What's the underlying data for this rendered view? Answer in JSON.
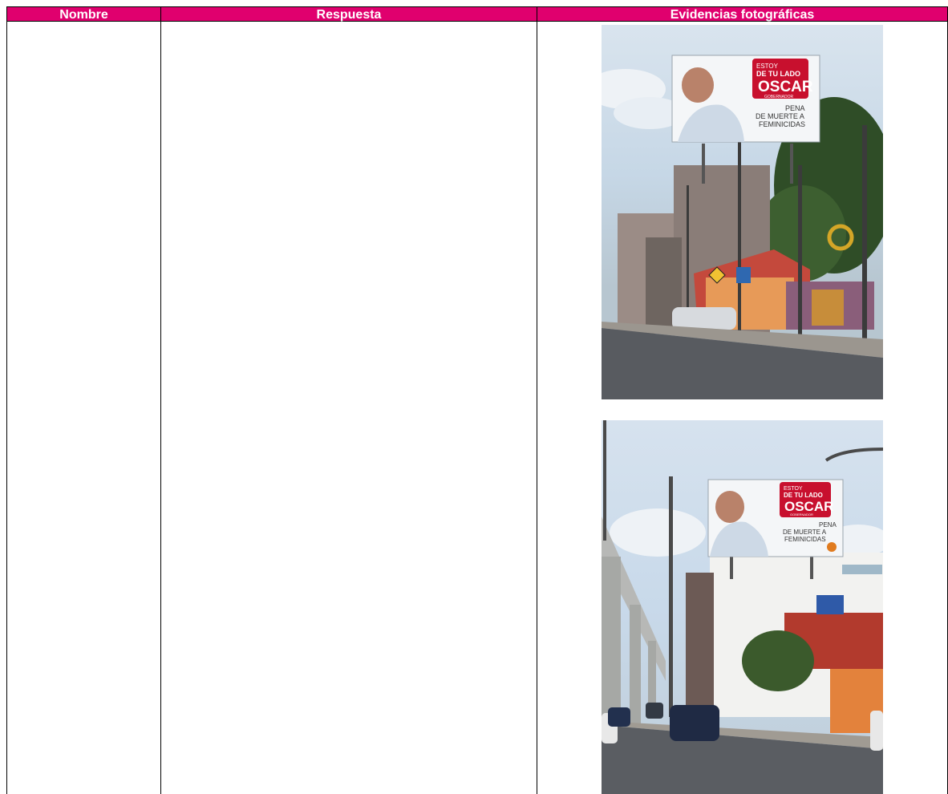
{
  "table": {
    "headers": {
      "nombre": "Nombre",
      "respuesta": "Respuesta",
      "evidencias": "Evidencias fotográficas"
    }
  },
  "photos": [
    {
      "billboard": {
        "line1": "ESTOY",
        "line2": "DE TU LADO",
        "name": "OSCAR",
        "sub": "GOBERNADOR",
        "slogan1": "PENA",
        "slogan2": "DE MUERTE A",
        "slogan3": "FEMINICIDAS"
      }
    },
    {
      "billboard": {
        "line1": "ESTOY",
        "line2": "DE TU LADO",
        "name": "OSCAR",
        "sub": "GOBERNADOR",
        "slogan1": "PENA",
        "slogan2": "DE MUERTE A",
        "slogan3": "FEMINICIDAS"
      }
    }
  ],
  "colors": {
    "header_bg": "#e0006e",
    "header_text": "#ffffff",
    "brand_red": "#c8102e"
  }
}
